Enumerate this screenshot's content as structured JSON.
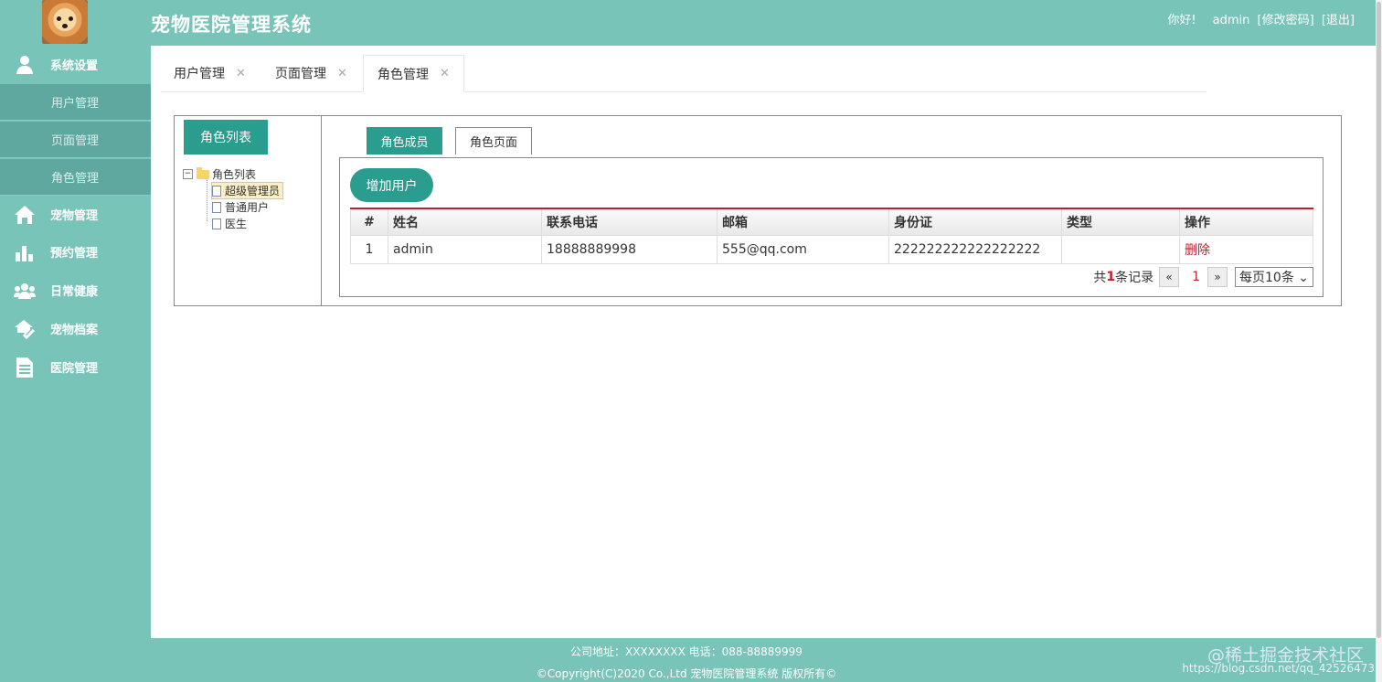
{
  "header": {
    "title": "宠物医院管理系统",
    "greeting": "你好!",
    "username": "admin",
    "change_password": "[修改密码]",
    "logout": "[退出]"
  },
  "sidebar": {
    "items": [
      {
        "label": "系统设置",
        "icon": "user-icon"
      },
      {
        "label": "宠物管理",
        "icon": "home-icon"
      },
      {
        "label": "预约管理",
        "icon": "bar-chart-icon"
      },
      {
        "label": "日常健康",
        "icon": "group-icon"
      },
      {
        "label": "宠物档案",
        "icon": "house-check-icon"
      },
      {
        "label": "医院管理",
        "icon": "document-icon"
      }
    ],
    "subitems": [
      "用户管理",
      "页面管理",
      "角色管理"
    ]
  },
  "tabs": [
    {
      "label": "用户管理",
      "close": "✕"
    },
    {
      "label": "页面管理",
      "close": "✕"
    },
    {
      "label": "角色管理",
      "close": "✕"
    }
  ],
  "role_panel": {
    "button": "角色列表",
    "tree_root": "角色列表",
    "tree_nodes": [
      "超级管理员",
      "普通用户",
      "医生"
    ]
  },
  "subtabs": {
    "members": "角色成员",
    "pages": "角色页面"
  },
  "add_user_button": "增加用户",
  "table": {
    "headers": [
      "#",
      "姓名",
      "联系电话",
      "邮箱",
      "身份证",
      "类型",
      "操作"
    ],
    "rows": [
      [
        "1",
        "admin",
        "18888889998",
        "555@qq.com",
        "222222222222222222",
        "",
        "删除"
      ]
    ]
  },
  "pager": {
    "prefix": "共",
    "count": "1",
    "suffix": "条记录",
    "prev": "«",
    "page": "1",
    "next": "»",
    "page_size": "每页10条 ⌄"
  },
  "footer": {
    "address": "公司地址：XXXXXXXX 电话：088-88889999",
    "copyright": "©Copyright(C)2020 Co.,Ltd 宠物医院管理系统 版权所有©"
  },
  "watermark": {
    "brand": "@稀土掘金技术社区",
    "url": "https://blog.csdn.net/qq_42526473"
  },
  "colors": {
    "sidebar_bg": "#79c4b9",
    "accent": "#2a9d8f",
    "danger": "#c21d2f"
  }
}
